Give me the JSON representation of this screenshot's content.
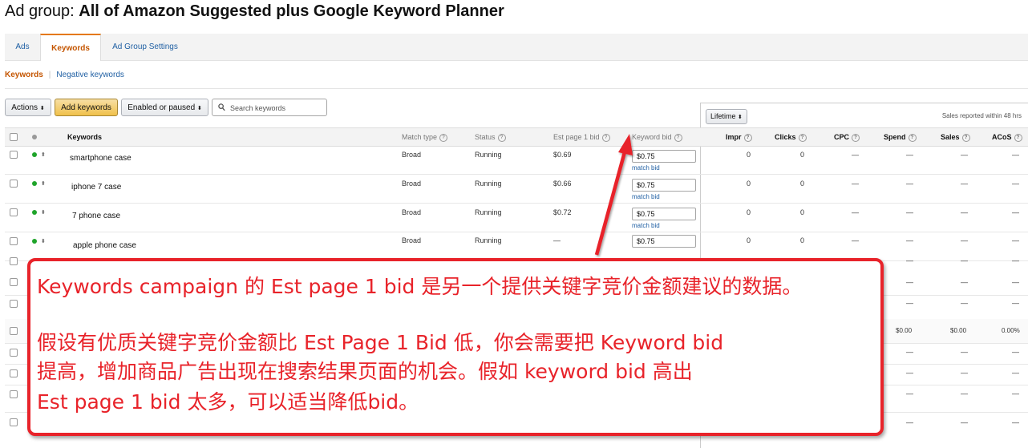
{
  "title": {
    "prefix": "Ad group:",
    "name": "All of Amazon Suggested plus Google Keyword Planner"
  },
  "tabs": [
    {
      "label": "Ads",
      "active": false
    },
    {
      "label": "Keywords",
      "active": true
    },
    {
      "label": "Ad Group Settings",
      "active": false
    }
  ],
  "subnav": {
    "active": "Keywords",
    "other": "Negative keywords"
  },
  "toolbar": {
    "actions_label": "Actions",
    "add_label": "Add keywords",
    "filter_label": "Enabled or paused",
    "search_placeholder": "Search keywords"
  },
  "date_range": {
    "label": "Lifetime",
    "note": "Sales reported within 48 hrs"
  },
  "columns": {
    "keywords": "Keywords",
    "match_type": "Match type",
    "status": "Status",
    "est_bid": "Est page 1 bid",
    "keyword_bid": "Keyword bid",
    "impr": "Impr",
    "clicks": "Clicks",
    "cpc": "CPC",
    "spend": "Spend",
    "sales": "Sales",
    "acos": "ACoS"
  },
  "rows": [
    {
      "keyword": "smartphone case",
      "match": "Broad",
      "status": "Running",
      "est_bid": "$0.69",
      "bid": "$0.75",
      "match_bid": "match bid",
      "impr": "0",
      "clicks": "0",
      "cpc": "—",
      "spend": "—",
      "sales": "—",
      "acos": "—"
    },
    {
      "keyword": "iphone 7 case",
      "match": "Broad",
      "status": "Running",
      "est_bid": "$0.66",
      "bid": "$0.75",
      "match_bid": "match bid",
      "impr": "0",
      "clicks": "0",
      "cpc": "—",
      "spend": "—",
      "sales": "—",
      "acos": "—"
    },
    {
      "keyword": "7 phone case",
      "match": "Broad",
      "status": "Running",
      "est_bid": "$0.72",
      "bid": "$0.75",
      "match_bid": "match bid",
      "impr": "0",
      "clicks": "0",
      "cpc": "—",
      "spend": "—",
      "sales": "—",
      "acos": "—"
    },
    {
      "keyword": "apple phone case",
      "match": "Broad",
      "status": "Running",
      "est_bid": "—",
      "bid": "$0.75",
      "match_bid": "",
      "impr": "0",
      "clicks": "0",
      "cpc": "—",
      "spend": "—",
      "sales": "—",
      "acos": "—"
    }
  ],
  "hidden_rows_right": [
    {
      "vals": [
        "—",
        "—",
        "—"
      ]
    },
    {
      "vals": [
        "—",
        "—",
        "—"
      ]
    },
    {
      "vals": [
        "—",
        "—",
        "—"
      ]
    },
    {
      "vals": [
        "$0.00",
        "$0.00",
        "0.00%"
      ]
    },
    {
      "vals": [
        "—",
        "—",
        "—"
      ]
    },
    {
      "vals": [
        "—",
        "—",
        "—"
      ]
    },
    {
      "vals": [
        "—",
        "—",
        "—"
      ]
    },
    {
      "vals": [
        "—",
        "—",
        "—"
      ]
    }
  ],
  "annotation": {
    "line1": "Keywords campaign 的 Est page 1 bid 是另一个提供关键字竞价金额建议的数据。",
    "line2": "假设有优质关键字竞价金额比 Est Page 1 Bid 低，你会需要把 Keyword bid",
    "line3": "提高，增加商品广告出现在搜索结果页面的机会。假如 keyword bid 高出",
    "line4": "Est page 1 bid 太多，可以适当降低bid。",
    "color": "#e8232a"
  }
}
